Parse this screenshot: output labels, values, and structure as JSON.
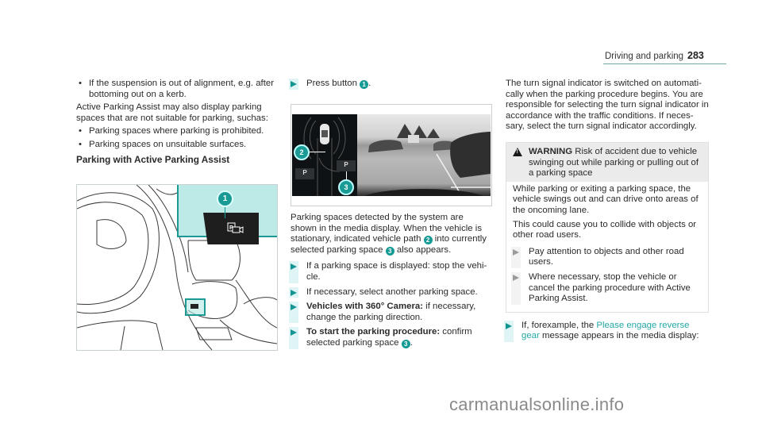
{
  "header": {
    "section": "Driving and parking",
    "page": "283"
  },
  "col1": {
    "bullet1": "If the suspension is out of alignment, e.g. after bottoming out on a kerb.",
    "para": "Active Parking Assist may also display parking spaces that are not suitable for parking, suchas:",
    "bullets": [
      "Parking spaces where parking is prohibited.",
      "Parking spaces on unsuitable surfaces."
    ],
    "heading": "Parking with Active Parking Assist",
    "figure": {
      "callout": "1",
      "button_icon": "parking-camera-icon"
    }
  },
  "col2": {
    "step1_pre": "Press button",
    "step1_num": "1",
    "step1_post": ".",
    "figure": {
      "callout2": "2",
      "callout3": "3",
      "slot_label": "P"
    },
    "para_a": "Parking spaces detected by the system are shown in the media display. When the vehicle is station­ary, indicated vehicle path",
    "para_num2": "2",
    "para_b": "into currently selec­ted parking space",
    "para_num3": "3",
    "para_c": "also appears.",
    "steps": [
      {
        "bold": "",
        "text": "If a parking space is displayed: stop the vehi­cle."
      },
      {
        "bold": "",
        "text": "If necessary, select another parking space."
      },
      {
        "bold": "Vehicles with 360° Camera:",
        "text": " if necessary, change the parking direction."
      },
      {
        "bold": "To start the parking procedure:",
        "text": " confirm selec­ted parking space",
        "num": "3",
        "end": "."
      }
    ]
  },
  "col3": {
    "para": "The turn signal indicator is switched on automati­cally when the parking procedure begins. You are responsible for selecting the turn signal indicator in accordance with the traffic conditions. If neces­sary, select the turn signal indicator accordingly.",
    "warning": {
      "label": "WARNING",
      "title": " Risk of accident due to vehicle swinging out while parking or pulling out of a parking space",
      "body1": "While parking or exiting a parking space, the vehicle swings out and can drive onto areas of the oncoming lane.",
      "body2": "This could cause you to collide with objects or other road users.",
      "steps": [
        "Pay attention to objects and other road users.",
        "Where necessary, stop the vehicle or cancel the parking procedure with Active Parking Assist."
      ]
    },
    "final_pre": "If, forexample, the ",
    "final_msg": "Please engage reverse gear",
    "final_post": " message appears in the media display:"
  },
  "watermark": "carmanualsonline.info",
  "colors": {
    "accent": "#149591",
    "message": "#25a7a5",
    "highlight": "#bdeae7"
  }
}
